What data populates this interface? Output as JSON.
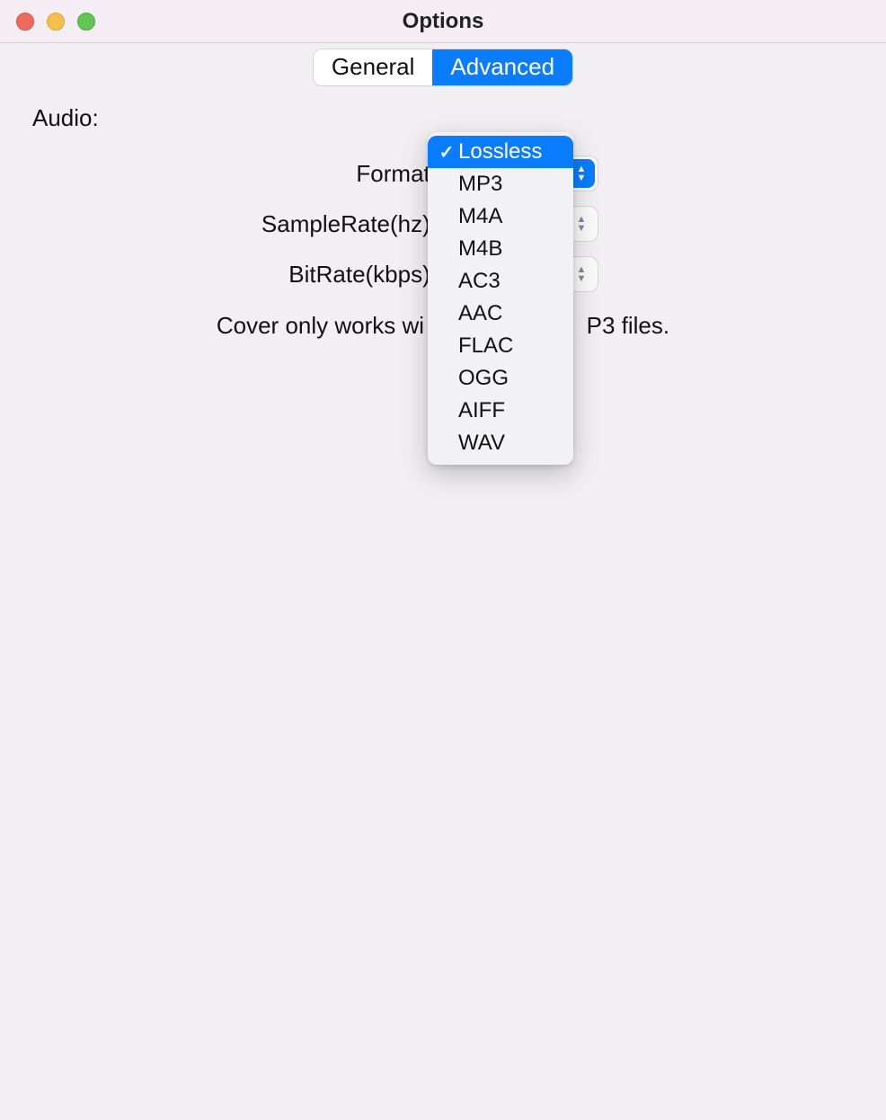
{
  "window": {
    "title": "Options"
  },
  "tabs": {
    "general": "General",
    "advanced": "Advanced"
  },
  "audio": {
    "section_label": "Audio:",
    "format_label": "Format:",
    "samplerate_label": "SampleRate(hz):",
    "bitrate_label": "BitRate(kbps):",
    "note_prefix": "Cover only works wi",
    "note_suffix": "P3 files.",
    "format_options": {
      "selected": "Lossless",
      "items": [
        "Lossless",
        "MP3",
        "M4A",
        "M4B",
        "AC3",
        "AAC",
        "FLAC",
        "OGG",
        "AIFF",
        "WAV"
      ]
    }
  }
}
